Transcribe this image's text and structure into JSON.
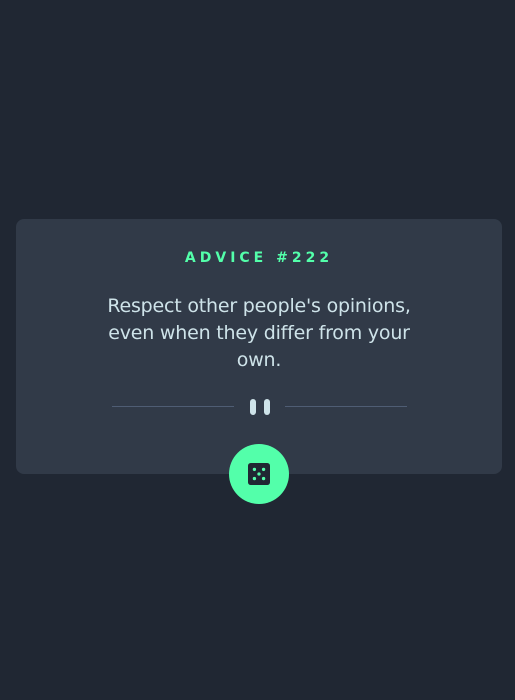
{
  "advice": {
    "id_label": "ADVICE #222",
    "text": "Respect other people's opinions, even when they differ from your own."
  },
  "colors": {
    "background": "#202733",
    "card": "#313a48",
    "accent": "#53ffaa",
    "text": "#cee3e9",
    "divider": "#4f5d74"
  },
  "icons": {
    "divider_center": "pause-icon",
    "button": "dice-icon"
  }
}
